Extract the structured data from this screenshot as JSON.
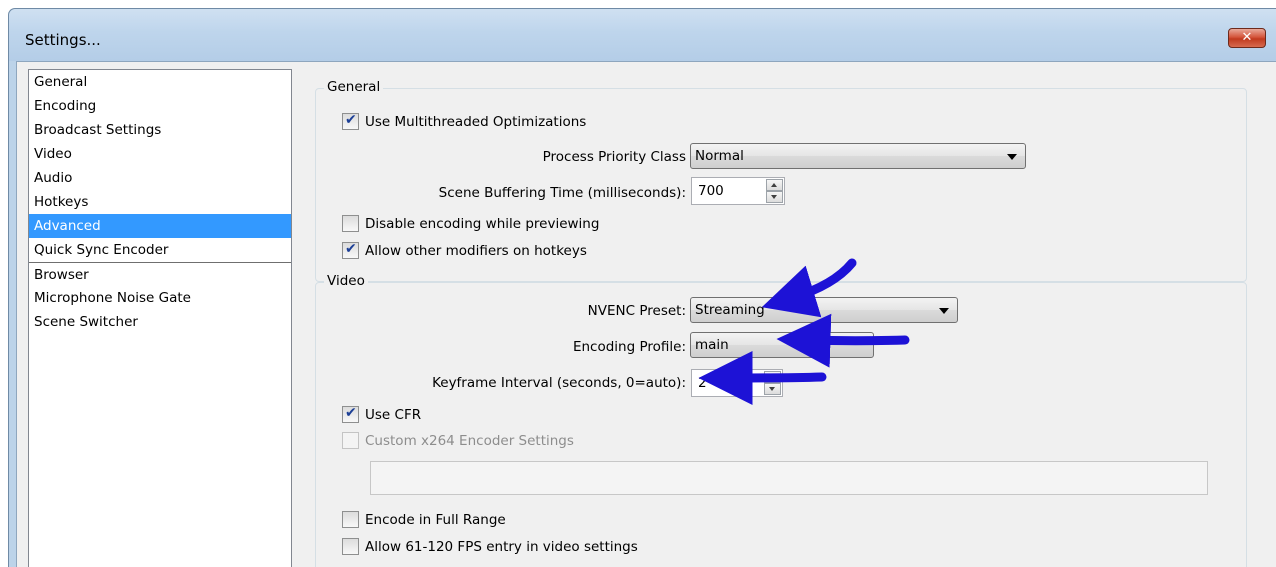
{
  "window": {
    "title": "Settings...",
    "close_label": "✕"
  },
  "nav": {
    "items": [
      {
        "label": "General"
      },
      {
        "label": "Encoding"
      },
      {
        "label": "Broadcast Settings"
      },
      {
        "label": "Video"
      },
      {
        "label": "Audio"
      },
      {
        "label": "Hotkeys"
      },
      {
        "label": "Advanced"
      },
      {
        "label": "Quick Sync Encoder"
      },
      {
        "label": "Browser"
      },
      {
        "label": "Microphone Noise Gate"
      },
      {
        "label": "Scene Switcher"
      }
    ],
    "selected": "Advanced"
  },
  "general": {
    "title": "General",
    "multithreaded": {
      "label": "Use Multithreaded Optimizations",
      "checked": true
    },
    "priority": {
      "label": "Process Priority Class",
      "value": "Normal"
    },
    "buffering": {
      "label": "Scene Buffering Time (milliseconds):",
      "value": "700"
    },
    "disable_encoding": {
      "label": "Disable encoding while previewing",
      "checked": false
    },
    "allow_modifiers": {
      "label": "Allow other modifiers on hotkeys",
      "checked": true
    }
  },
  "video": {
    "title": "Video",
    "nvenc_preset": {
      "label": "NVENC Preset:",
      "value": "Streaming"
    },
    "encoding_profile": {
      "label": "Encoding Profile:",
      "value": "main"
    },
    "keyframe": {
      "label": "Keyframe Interval (seconds, 0=auto):",
      "value": "2"
    },
    "use_cfr": {
      "label": "Use CFR",
      "checked": true
    },
    "custom_x264": {
      "label": "Custom x264 Encoder Settings",
      "checked": false,
      "disabled": true,
      "value": ""
    },
    "full_range": {
      "label": "Encode in Full Range",
      "checked": false
    },
    "allow_fps": {
      "label": "Allow 61-120 FPS entry in video settings",
      "checked": false
    }
  },
  "annotation": {
    "arrow_color": "#1d12d6"
  }
}
